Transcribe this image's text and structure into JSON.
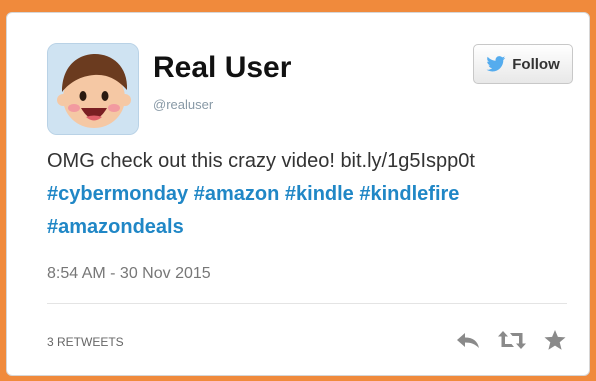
{
  "user": {
    "display_name": "Real User",
    "handle": "@realuser"
  },
  "follow_button": {
    "label": "Follow",
    "icon": "twitter-bird-icon"
  },
  "tweet": {
    "text": "OMG check out this crazy video! bit.ly/1g5Ispp0t",
    "hashtags": [
      "#cybermonday",
      "#amazon",
      "#kindle",
      "#kindlefire",
      "#amazondeals"
    ],
    "timestamp": "8:54 AM - 30 Nov 2015",
    "retweets": "3 RETWEETS"
  },
  "actions": [
    "reply-icon",
    "retweet-icon",
    "favorite-star-icon"
  ],
  "colors": {
    "background": "#f08a3c",
    "hashtag": "#2087c6",
    "twitter_blue": "#55acee"
  }
}
